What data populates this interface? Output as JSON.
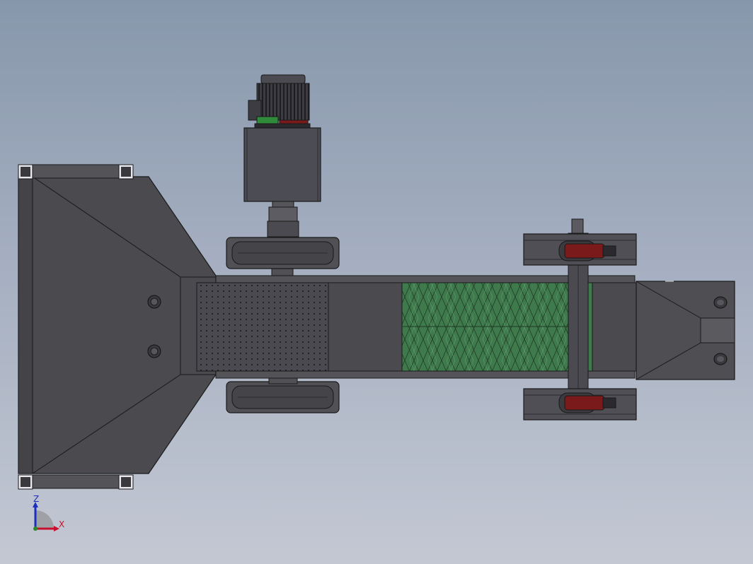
{
  "triad": {
    "z_label": "Z",
    "x_label": "X",
    "z_color": "#1a2fbf",
    "x_color": "#c8102e",
    "y_color": "#2a8a2a"
  },
  "colors": {
    "background_top": "#8797ab",
    "background_bottom": "#c3c8d3",
    "metal_dark": "#4b4b4f",
    "metal_mid": "#5a5a60",
    "motor": "#48484f",
    "screen_green": "#3f7a4c",
    "caster_red": "#7a1a1a",
    "edge": "#1a1a1a"
  }
}
